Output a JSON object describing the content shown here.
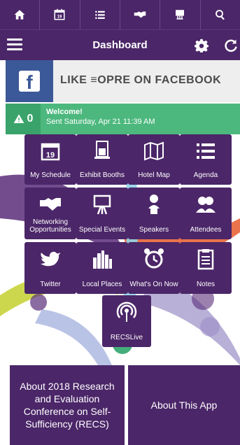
{
  "topnav": [
    {
      "icon": "home-icon"
    },
    {
      "icon": "calendar-icon",
      "text": "19"
    },
    {
      "icon": "list-icon"
    },
    {
      "icon": "handshake-icon"
    },
    {
      "icon": "booth-icon"
    },
    {
      "icon": "search-icon"
    }
  ],
  "header": {
    "title": "Dashboard"
  },
  "banner": {
    "text": "LIKE ≡OPRE ON FACEBOOK",
    "fb": "f"
  },
  "notification": {
    "count": "0",
    "title": "Welcome!",
    "sent": "Sent Saturday, Apr 21 11:39 AM"
  },
  "tiles": {
    "my_schedule": "My Schedule",
    "exhibit_booths": "Exhibit Booths",
    "hotel_map": "Hotel Map",
    "agenda": "Agenda",
    "networking": "Networking Opportunities",
    "special_events": "Special Events",
    "speakers": "Speakers",
    "attendees": "Attendees",
    "twitter": "Twitter",
    "local_places": "Local Places",
    "whats_on_now": "What's On Now",
    "notes": "Notes",
    "recslive": "RECSLive",
    "calendar_day": "19"
  },
  "bottom": {
    "about_conference": "About 2018 Research and Evaluation Conference on Self-Sufficiency (RECS)",
    "about_app": "About This App"
  },
  "colors": {
    "primary": "#4b2668",
    "notification": "#4db87e",
    "facebook": "#3b5998"
  }
}
